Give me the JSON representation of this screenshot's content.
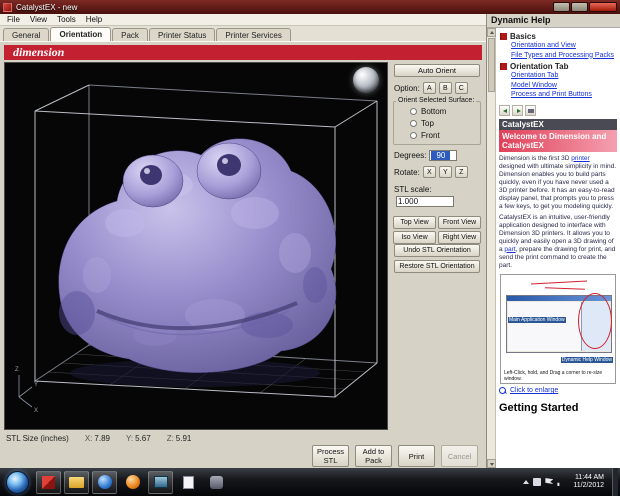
{
  "window": {
    "title": "CatalystEX - new",
    "menu": [
      "File",
      "View",
      "Tools",
      "Help"
    ],
    "tabs": [
      "General",
      "Orientation",
      "Pack",
      "Printer Status",
      "Printer Services"
    ]
  },
  "brand": {
    "logo": "dimension"
  },
  "panel": {
    "auto_orient": "Auto Orient",
    "option_label": "Option:",
    "options": [
      "A",
      "B",
      "C"
    ],
    "orient_group": "Orient Selected Surface:",
    "orient_radios": [
      "Bottom",
      "Top",
      "Front"
    ],
    "degrees_label": "Degrees:",
    "degrees_value": "90",
    "rotate_label": "Rotate:",
    "rotate_axes": [
      "X",
      "Y",
      "Z"
    ],
    "scale_label": "STL scale:",
    "scale_value": "1.000",
    "views": [
      "Top View",
      "Front View",
      "Iso View",
      "Right View"
    ],
    "undo": "Undo STL Orientation",
    "restore": "Restore STL Orientation"
  },
  "viewport": {
    "axes": [
      "Z",
      "Y",
      "X"
    ]
  },
  "status": {
    "label": "STL Size (inches)",
    "x_label": "X:",
    "x_value": "7.89",
    "y_label": "Y:",
    "y_value": "5.67",
    "z_label": "Z:",
    "z_value": "5.91"
  },
  "actions": {
    "process": "Process STL",
    "add": "Add to Pack",
    "print": "Print",
    "cancel": "Cancel"
  },
  "help": {
    "title": "Dynamic Help",
    "sections": [
      {
        "heading": "Basics",
        "links": [
          "Orientation and View",
          "File Types and Processing Packs"
        ]
      },
      {
        "heading": "Orientation Tab",
        "links": [
          "Orientation Tab",
          "Model Window",
          "Process and Print Buttons"
        ]
      }
    ],
    "app_name": "CatalystEX",
    "welcome": "Welcome to Dimension and CatalystEX",
    "para1_pre": "Dimension is the first 3D ",
    "para1_link": "printer",
    "para1_post": " designed with ultimate simplicity in mind. Dimension enables you to build parts quickly, even if you have never used a 3D printer before. It has an easy-to-read display panel, that prompts you to press a few keys, to get you modeling quickly.",
    "para2_pre": "CatalystEX is an intuitive, user-friendly application designed to interface with Dimension 3D printers. It allows you to quickly and easily open a 3D drawing of a ",
    "para2_link": "part",
    "para2_post": ", prepare the drawing for print, and send the print command to create the part.",
    "thumb_label_main": "Main Application Window",
    "thumb_label_help": "Dynamic Help Window",
    "thumb_caption": "Left-Click, hold, and Drag a corner to re-size window.",
    "enlarge": "Click to enlarge",
    "getting_started": "Getting Started"
  },
  "taskbar": {
    "time": "11:44 AM",
    "date": "11/2/2012"
  }
}
